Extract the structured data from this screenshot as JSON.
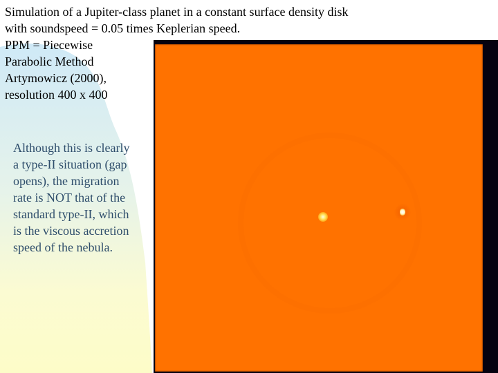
{
  "slide": {
    "title_lines": [
      "Simulation of a Jupiter-class planet in a constant surface density disk",
      "with soundspeed = 0.05 times Keplerian speed.",
      "PPM = Piecewise",
      "Parabolic Method",
      "Artymowicz (2000),",
      "resolution 400 x 400"
    ],
    "body_lines": [
      "Although this is clearly",
      "a type-II situation (gap",
      "opens), the migration",
      "rate is NOT that of the",
      "standard type-II, which",
      "is the viscous accretion",
      "speed of the nebula."
    ]
  },
  "simulation": {
    "description": "Disk surface density map with central star and embedded planet",
    "colors": {
      "field": "#ff7200",
      "frame": "#05020f",
      "star_core": "#fffbe0",
      "planet_core": "#ffffff"
    }
  },
  "theme": {
    "title_color": "#000000",
    "body_color": "#2e4d6b",
    "wave_blue": "#cfe9f7",
    "wave_yellow": "#fdfcc8"
  }
}
